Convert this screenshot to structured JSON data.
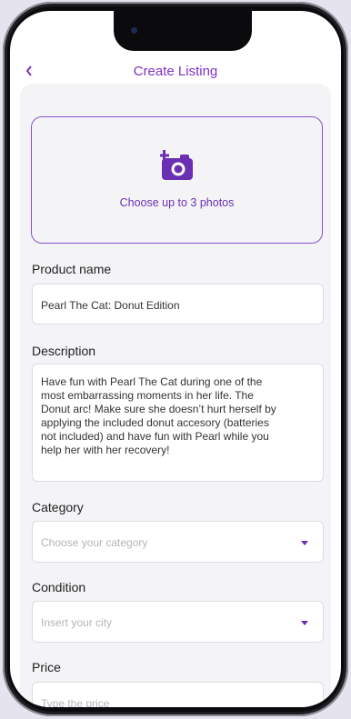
{
  "header": {
    "title": "Create Listing",
    "back_icon": "chevron-left-icon"
  },
  "photos": {
    "prompt": "Choose up to 3 photos",
    "icon": "add-camera-icon"
  },
  "product_name": {
    "label": "Product name",
    "value": "Pearl The Cat: Donut Edition"
  },
  "description": {
    "label": "Description",
    "lines": [
      "Have fun with Pearl The Cat during one of the",
      "most embarrassing moments in her life. The",
      "Donut arc! Make sure she doesn’t hurt herself by",
      "applying the included donut accesory (batteries",
      "not included) and have fun with Pearl while you",
      "help her with her recovery!"
    ]
  },
  "category": {
    "label": "Category",
    "placeholder": "Choose your category"
  },
  "condition": {
    "label": "Condition",
    "placeholder": "Insert your city"
  },
  "price": {
    "label": "Price",
    "placeholder": "Type the price"
  },
  "colors": {
    "accent": "#7f33c7",
    "background": "#f4f4f7"
  }
}
